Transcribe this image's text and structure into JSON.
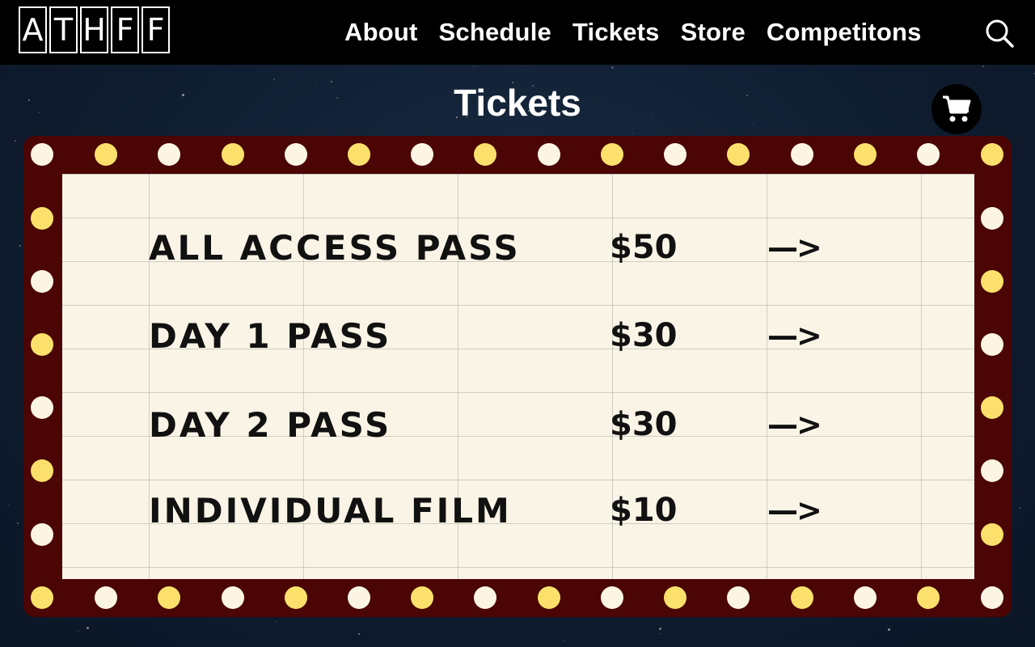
{
  "logo": {
    "letters": [
      "A",
      "T",
      "H",
      "F",
      "F"
    ]
  },
  "nav": {
    "items": [
      "About",
      "Schedule",
      "Tickets",
      "Store",
      "Competitons"
    ],
    "search_icon": "search-icon"
  },
  "page": {
    "title": "Tickets",
    "cart_icon": "shopping-cart-icon"
  },
  "tickets": [
    {
      "name": "ALL ACCESS PASS",
      "price": "$50",
      "arrow": "—>"
    },
    {
      "name": "DAY 1 PASS",
      "price": "$30",
      "arrow": "—>"
    },
    {
      "name": "DAY 2 PASS",
      "price": "$30",
      "arrow": "—>"
    },
    {
      "name": "INDIVIDUAL FILM",
      "price": "$10",
      "arrow": "—>"
    }
  ],
  "colors": {
    "nav_bg": "#000000",
    "background": "#13233a",
    "marquee_frame": "#4a0504",
    "bulb_white": "#fdf5e4",
    "bulb_yellow": "#fbe16b",
    "board": "#f9f4e6",
    "text_dark": "#111111"
  }
}
